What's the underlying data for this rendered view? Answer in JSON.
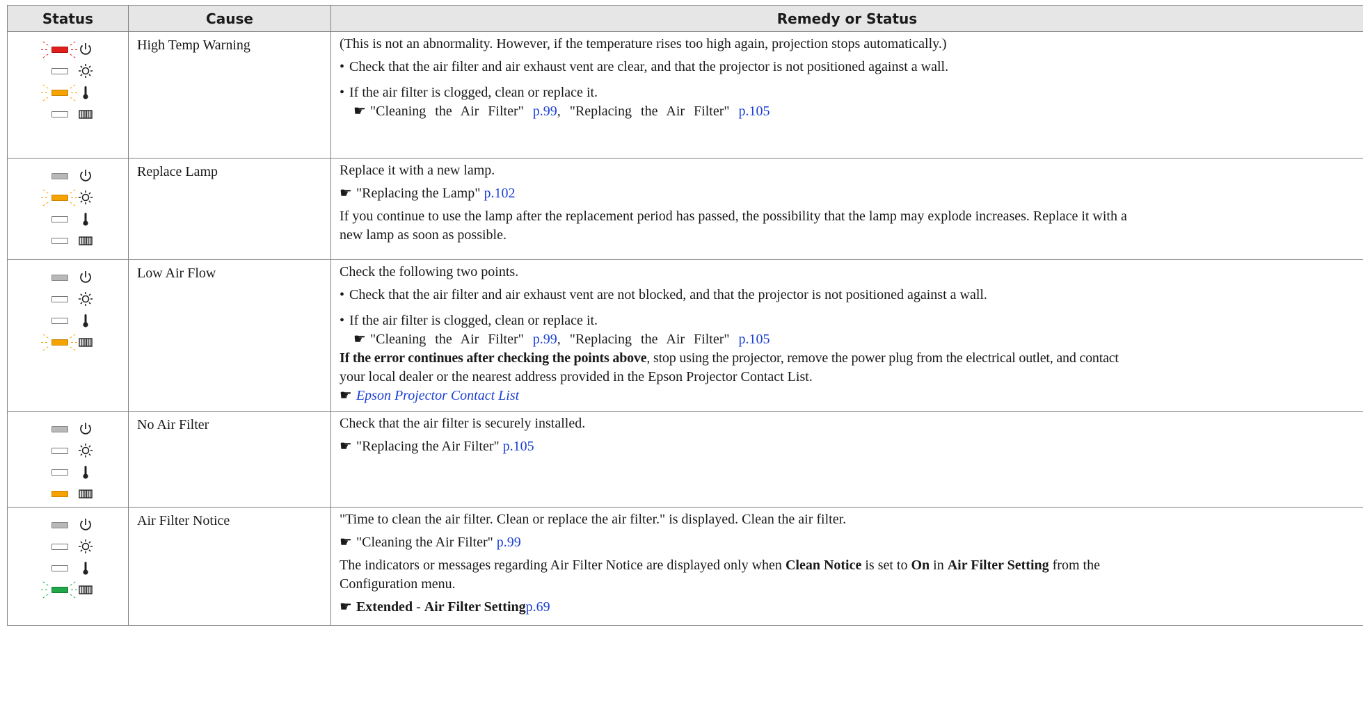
{
  "headers": {
    "status": "Status",
    "cause": "Cause",
    "remedy": "Remedy or Status"
  },
  "rows": [
    {
      "cause": "High Temp Warning",
      "indicators": [
        {
          "icon": "power-icon",
          "state": "red-flashing"
        },
        {
          "icon": "lamp-icon",
          "state": "off"
        },
        {
          "icon": "temp-icon",
          "state": "orange-flashing"
        },
        {
          "icon": "filter-icon",
          "state": "off"
        }
      ],
      "remedy": {
        "intro": "(This is not an abnormality. However, if the temperature rises too high again, projection stops automatically.)",
        "bullet1": "Check that the air filter and air exhaust vent are clear, and that the projector is not positioned against a wall.",
        "bullet2": "If the air filter is clogged, clean or replace it.",
        "ref1_text": "\"Cleaning the Air Filter\"",
        "ref1_link": "p.99",
        "ref2_text": "\"Replacing the Air Filter\"",
        "ref2_link": "p.105"
      }
    },
    {
      "cause": "Replace Lamp",
      "indicators": [
        {
          "icon": "power-icon",
          "state": "gray"
        },
        {
          "icon": "lamp-icon",
          "state": "orange-flashing"
        },
        {
          "icon": "temp-icon",
          "state": "off"
        },
        {
          "icon": "filter-icon",
          "state": "off"
        }
      ],
      "remedy": {
        "line1": "Replace it with a new lamp.",
        "ref_text": "\"Replacing the Lamp\"",
        "ref_link": "p.102",
        "line2a": "If you continue to use the lamp after the replacement period has passed, the possibility that the lamp may explode increases. Replace it with a",
        "line2b": "new lamp as soon as possible."
      }
    },
    {
      "cause": "Low Air Flow",
      "indicators": [
        {
          "icon": "power-icon",
          "state": "gray"
        },
        {
          "icon": "lamp-icon",
          "state": "off"
        },
        {
          "icon": "temp-icon",
          "state": "off"
        },
        {
          "icon": "filter-icon",
          "state": "orange-flashing"
        }
      ],
      "remedy": {
        "line1": "Check the following two points.",
        "bullet1": "Check that the air filter and air exhaust vent are not blocked, and that the projector is not positioned against a wall.",
        "bullet2": "If the air filter is clogged, clean or replace it.",
        "ref1_text": "\"Cleaning the Air Filter\"",
        "ref1_link": "p.99",
        "ref2_text": "\"Replacing the Air Filter\"",
        "ref2_link": "p.105",
        "bold_lead": "If the error continues after checking the points above",
        "line3a": ", stop using the projector, remove the power plug from the electrical outlet, and contact",
        "line3b": "your local dealer or the nearest address provided in the Epson Projector Contact List.",
        "contact_link": "Epson Projector Contact List"
      }
    },
    {
      "cause": "No Air Filter",
      "indicators": [
        {
          "icon": "power-icon",
          "state": "gray"
        },
        {
          "icon": "lamp-icon",
          "state": "off"
        },
        {
          "icon": "temp-icon",
          "state": "off"
        },
        {
          "icon": "filter-icon",
          "state": "orange"
        }
      ],
      "remedy": {
        "line1": "Check that the air filter is securely installed.",
        "ref_text": "\"Replacing the Air Filter\"",
        "ref_link": "p.105"
      }
    },
    {
      "cause": "Air Filter Notice",
      "indicators": [
        {
          "icon": "power-icon",
          "state": "gray"
        },
        {
          "icon": "lamp-icon",
          "state": "off"
        },
        {
          "icon": "temp-icon",
          "state": "off"
        },
        {
          "icon": "filter-icon",
          "state": "green-flashing"
        }
      ],
      "remedy": {
        "line1": "\"Time to clean the air filter. Clean or replace the air filter.\" is displayed. Clean the air filter.",
        "ref_text": "\"Cleaning the Air Filter\"",
        "ref_link": "p.99",
        "l2_a": "The indicators or messages regarding Air Filter Notice are displayed only when ",
        "l2_b": "Clean Notice",
        "l2_c": " is set to ",
        "l2_d": "On",
        "l2_e": " in ",
        "l2_f": "Air Filter Setting",
        "l2_g": " from the",
        "l3": "Configuration menu.",
        "ext_a": "Extended",
        "ext_sep": " - ",
        "ext_b": "Air Filter Setting",
        "ext_link": "p.69"
      }
    }
  ],
  "colors": {
    "header_bg": "#e6e6e6",
    "border": "#808080",
    "link": "#1a3fd4",
    "red": "#e0201c",
    "orange": "#f5a300",
    "green": "#1fa74a"
  }
}
